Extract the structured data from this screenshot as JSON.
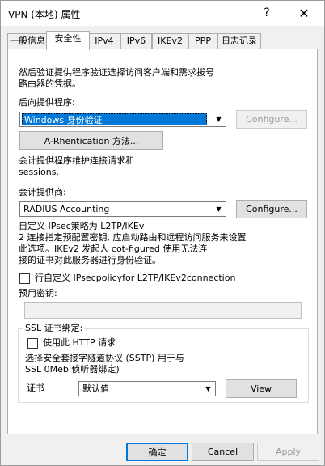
{
  "window": {
    "title": "VPN (本地) 属性",
    "help_glyph": "?",
    "close_glyph": "✕"
  },
  "tabs": [
    {
      "label": "一般信息"
    },
    {
      "label": "安全性"
    },
    {
      "label": "IPv4"
    },
    {
      "label": "IPv6"
    },
    {
      "label": "IKEv2"
    },
    {
      "label": "PPP"
    },
    {
      "label": "日志记录"
    }
  ],
  "active_tab": "安全性",
  "auth": {
    "description_line1": "然后验证提供程序验证选择访问客户端和需求拔号",
    "description_line2": "路由器的凭据。",
    "provider_label": "后向提供程序:",
    "provider_value": "Windows 身份验证",
    "configure_label": "Configure...",
    "methods_label": "A-Rhentication 方法..."
  },
  "accounting": {
    "description_line1": "会计提供程序维护连接请求和",
    "description_line2": "sessions.",
    "provider_label": "会计提供商:",
    "provider_value": "RADIUS Accounting",
    "configure_label": "Configure..."
  },
  "ipsec": {
    "line1": "自定义 IPsec策略为 L2TP/IKEv",
    "line2": "2 连接指定预配置密钥, 应启动路由和远程访问服务来设置",
    "line3": "此选项。IKEv2 发起人 cot-figured 使用无法连",
    "line4": "接的证书对此服务器进行身份验证。",
    "checkbox_label": "行自定义 IPsecpolicyfor L2TP/IKEv2connection",
    "preshared_label": "预用密钥:",
    "preshared_value": ""
  },
  "ssl": {
    "group_title": "SSL 证书绑定:",
    "http_label": "使用此 HTTP 请求",
    "desc_line1": "选择安全套接字隧道协议 (SSTP) 用于与",
    "desc_line2": "SSL 0Meb 侦听器绑定)",
    "cert_label": "证书",
    "cert_value": "默认值",
    "view_label": "View"
  },
  "footer": {
    "ok_label": "确定",
    "cancel_label": "Cancel",
    "apply_label": "Apply"
  },
  "icons": {
    "dropdown_arrow": "▼"
  }
}
